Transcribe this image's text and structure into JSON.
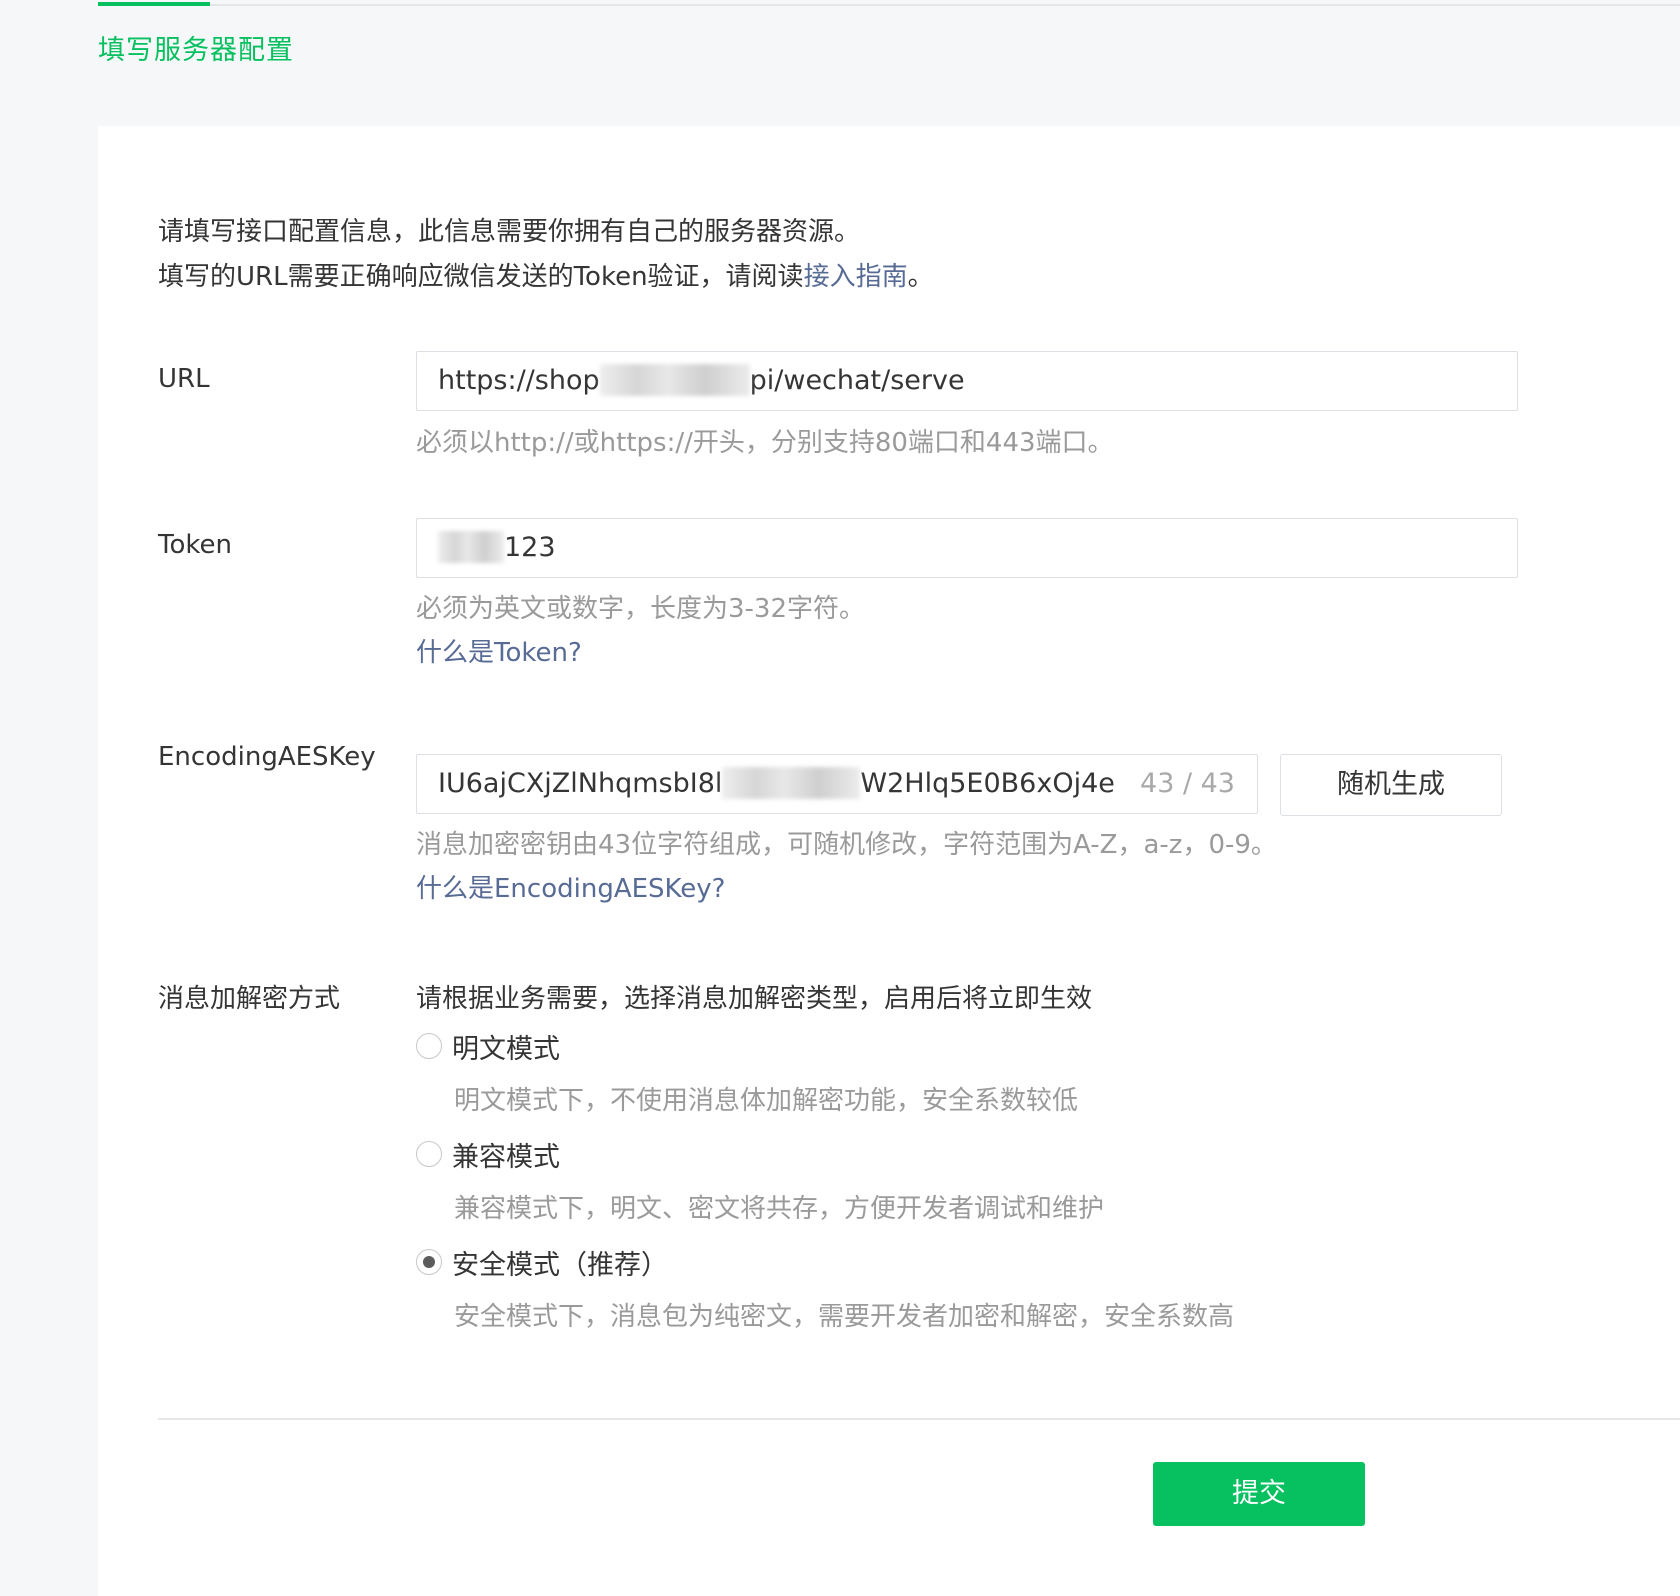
{
  "tab": {
    "title": "填写服务器配置"
  },
  "intro": {
    "line1": "请填写接口配置信息，此信息需要你拥有自己的服务器资源。",
    "line2_prefix": "填写的URL需要正确响应微信发送的Token验证，请阅读",
    "line2_link": "接入指南",
    "line2_suffix": "。"
  },
  "url": {
    "label": "URL",
    "value_visible_prefix": "https://shop",
    "value_visible_suffix": "pi/wechat/serve",
    "hint": "必须以http://或https://开头，分别支持80端口和443端口。"
  },
  "token": {
    "label": "Token",
    "value_visible_suffix": "123",
    "hint": "必须为英文或数字，长度为3-32字符。",
    "help_link": "什么是Token?"
  },
  "aes": {
    "label": "EncodingAESKey",
    "value_visible_prefix": "IU6ajCXjZlNhqmsbI8l",
    "value_visible_suffix": "W2Hlq5E0B6xOj4e",
    "counter": "43 / 43",
    "generate_button": "随机生成",
    "hint": "消息加密密钥由43位字符组成，可随机修改，字符范围为A-Z，a-z，0-9。",
    "help_link": "什么是EncodingAESKey?"
  },
  "encryption": {
    "label": "消息加解密方式",
    "description": "请根据业务需要，选择消息加解密类型，启用后将立即生效",
    "options": [
      {
        "label": "明文模式",
        "desc": "明文模式下，不使用消息体加解密功能，安全系数较低",
        "checked": false
      },
      {
        "label": "兼容模式",
        "desc": "兼容模式下，明文、密文将共存，方便开发者调试和维护",
        "checked": false
      },
      {
        "label": "安全模式（推荐）",
        "desc": "安全模式下，消息包为纯密文，需要开发者加密和解密，安全系数高",
        "checked": true
      }
    ]
  },
  "footer": {
    "submit": "提交"
  },
  "colors": {
    "accent": "#07c160",
    "link": "#576b95",
    "hint": "#9a9a9a"
  }
}
